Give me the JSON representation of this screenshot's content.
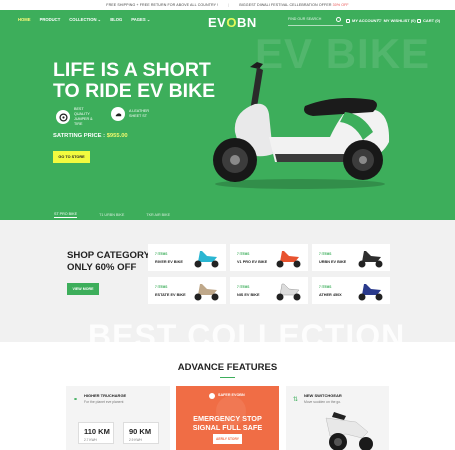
{
  "topbar": {
    "left": "FREE SHIPPING + FREE RETURN FOR ABOVE ALL COUNTRY !",
    "right_prefix": "BIGGEST DIWALI FESTIVAL CELLEBRATION OFFER",
    "right_highlight": "30% OFF"
  },
  "nav": {
    "menu": [
      "HOME",
      "PRODUCT",
      "COLLECTION",
      "BLOG",
      "PAGES"
    ],
    "logo_a": "EV",
    "logo_b": "O",
    "logo_c": "BN",
    "search_placeholder": "FIND OUR SEARCH",
    "account": "MY ACCOUNT",
    "wishlist": "MY WISHLIST (0)",
    "cart": "CART (0)"
  },
  "hero": {
    "watermark": "EV BIKE",
    "line1": "LIFE IS A SHORT",
    "line2": "TO RIDE EV BIKE",
    "feature1": "BEST QUALITY JUMPER & TIRE",
    "feature2": "A LEATHER SHEET ST",
    "price_label": "SATRTING PRICE :",
    "price_value": "$955.00",
    "button": "GO TO STORE",
    "tabs": [
      "ST PRO BIKE",
      "T1 URBN BIKE",
      "TKR AIR BIKE"
    ]
  },
  "categories": {
    "title_line1": "SHOP CATEGORY",
    "title_line2": "ONLY 60% OFF",
    "button": "VIEW MORE",
    "cards": [
      {
        "count": "7 ITEMS",
        "name": "RIVER EV BIKE",
        "color": "#2bb6d2"
      },
      {
        "count": "7 ITEMS",
        "name": "V1 PRO EV BIKE",
        "color": "#e8532f"
      },
      {
        "count": "7 ITEMS",
        "name": "URBN EV BIKE",
        "color": "#2e2e2e"
      },
      {
        "count": "7 ITEMS",
        "name": "ESTATE EV BIKE",
        "color": "#bfa88a"
      },
      {
        "count": "7 ITEMS",
        "name": "NIS EV BIKE",
        "color": "#ececec"
      },
      {
        "count": "7 ITEMS",
        "name": "ATHER 450X",
        "color": "#2a3a8c"
      }
    ],
    "watermark": "BEST COLLECTION"
  },
  "advance": {
    "title": "ADVANCE FEATURES",
    "panel1": {
      "title": "HIGHER TRUCHARGE",
      "subtitle": "For the planet eve planent",
      "box1_value": "110 KM",
      "box1_unit": "2.7 KWH",
      "box2_value": "90 KM",
      "box2_unit": "2.9 KWH"
    },
    "panel2": {
      "label": "SAFER EVOBN",
      "line1": "EMERGENCY STOP",
      "line2": "SIGNAL FULL SAFE",
      "button": "AERLY STORY"
    },
    "panel3": {
      "title": "NEW SWITCHGEAR",
      "subtitle": "Move suolden on the go."
    }
  },
  "colors": {
    "brand": "#3dae5b",
    "accent": "#f2fb3f",
    "orange": "#f06d45"
  }
}
